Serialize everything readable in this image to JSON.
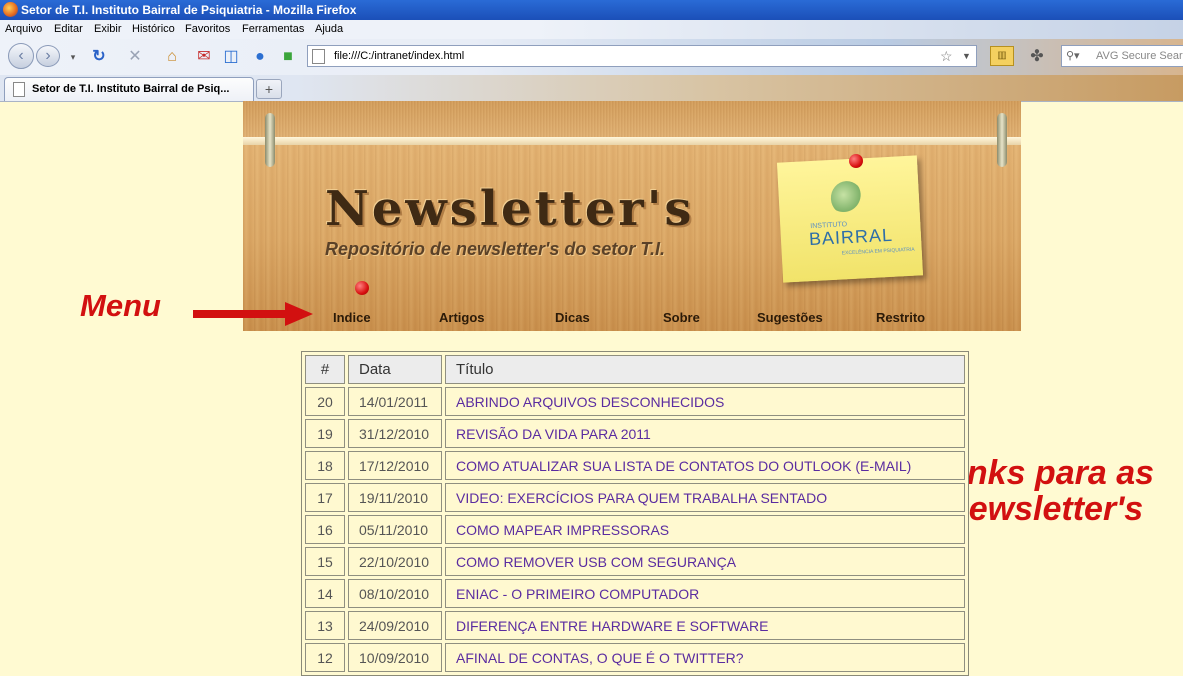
{
  "window": {
    "title": "Setor de T.I. Instituto Bairral de Psiquiatria - Mozilla Firefox"
  },
  "menu": [
    "Arquivo",
    "Editar",
    "Exibir",
    "Histórico",
    "Favoritos",
    "Ferramentas",
    "Ajuda"
  ],
  "address": {
    "url": "file:///C:/intranet/index.html"
  },
  "search": {
    "placeholder": "AVG Secure Search"
  },
  "tab": {
    "label": "Setor de T.I. Instituto Bairral de Psiq...",
    "new_tab": "+"
  },
  "banner": {
    "title": "Newsletter's",
    "subtitle": "Repositório de newsletter's do setor T.I.",
    "logo": {
      "name": "BAIRRAL",
      "small": "INSTITUTO",
      "tagline": "EXCELÊNCIA EM PSIQUIATRIA"
    }
  },
  "nav": [
    "Indice",
    "Artigos",
    "Dicas",
    "Sobre",
    "Sugestões",
    "Restrito"
  ],
  "annotations": {
    "menu": "Menu",
    "links": "links para as newsletter's"
  },
  "table": {
    "headers": [
      "#",
      "Data",
      "Título"
    ],
    "rows": [
      {
        "num": "20",
        "date": "14/01/2011",
        "title": "ABRINDO ARQUIVOS DESCONHECIDOS"
      },
      {
        "num": "19",
        "date": "31/12/2010",
        "title": "REVISÃO DA VIDA PARA 2011"
      },
      {
        "num": "18",
        "date": "17/12/2010",
        "title": "COMO ATUALIZAR SUA LISTA DE CONTATOS DO OUTLOOK (E-MAIL)"
      },
      {
        "num": "17",
        "date": "19/11/2010",
        "title": "VIDEO: EXERCÍCIOS PARA QUEM TRABALHA SENTADO"
      },
      {
        "num": "16",
        "date": "05/11/2010",
        "title": "COMO MAPEAR IMPRESSORAS"
      },
      {
        "num": "15",
        "date": "22/10/2010",
        "title": "COMO REMOVER USB COM SEGURANÇA"
      },
      {
        "num": "14",
        "date": "08/10/2010",
        "title": "ENIAC - O PRIMEIRO COMPUTADOR"
      },
      {
        "num": "13",
        "date": "24/09/2010",
        "title": "DIFERENÇA ENTRE HARDWARE E SOFTWARE"
      },
      {
        "num": "12",
        "date": "10/09/2010",
        "title": "AFINAL DE CONTAS, O QUE É O TWITTER?"
      }
    ]
  },
  "colors": {
    "annotation": "#d21010",
    "link": "#5a2ca0",
    "page_bg": "#fffad2"
  }
}
